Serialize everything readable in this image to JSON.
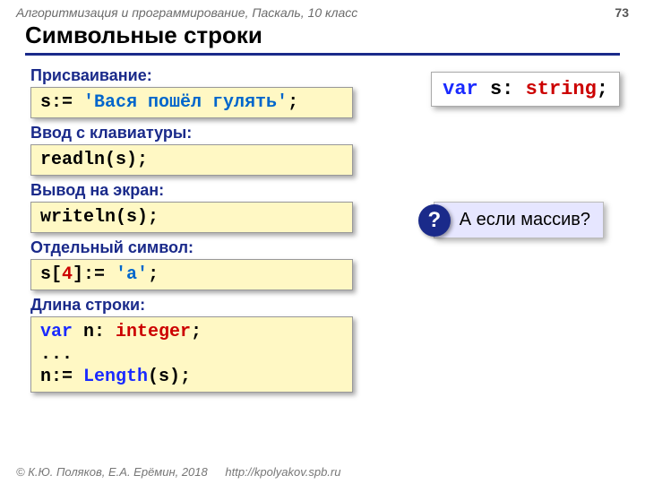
{
  "header": {
    "course": "Алгоритмизация и программирование, Паскаль, 10 класс",
    "page": "73"
  },
  "title": "Символьные строки",
  "decl": {
    "var": "var",
    "name": " s: ",
    "type": "string",
    "semi": ";"
  },
  "sections": {
    "assign": {
      "label": "Присваивание:",
      "s": "s:= ",
      "lit": "'Вася пошёл гулять'",
      "end": ";"
    },
    "input": {
      "label": "Ввод с клавиатуры:",
      "code": "readln(s);"
    },
    "output": {
      "label": "Вывод на экран:",
      "code": "writeln(s);"
    },
    "char": {
      "label": "Отдельный символ:",
      "a": "s[",
      "idx": "4",
      "b": "]:= ",
      "lit": "'a'",
      "end": ";"
    },
    "len": {
      "label": "Длина строки:",
      "l1": {
        "var": "var",
        "rest": " n: ",
        "type": "integer",
        "semi": ";"
      },
      "l2": "...",
      "l3": {
        "a": "n:= ",
        "fn": "Length",
        "b": "(s);"
      }
    }
  },
  "note": {
    "q": "?",
    "text": " А если массив?"
  },
  "footer": {
    "copy": "© К.Ю. Поляков, Е.А. Ерёмин, 2018",
    "url": "http://kpolyakov.spb.ru"
  }
}
